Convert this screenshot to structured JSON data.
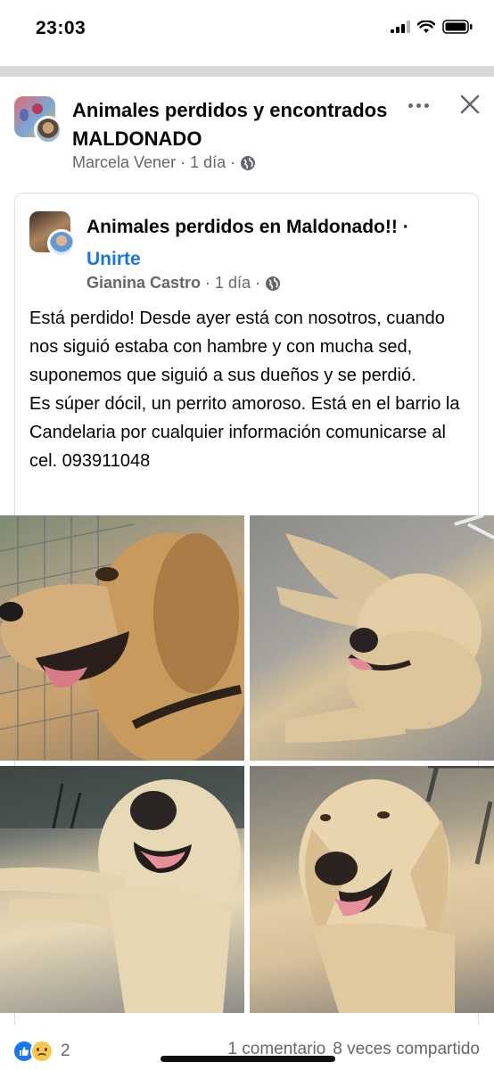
{
  "status_bar": {
    "time": "23:03"
  },
  "post": {
    "group_name": "Animales perdidos y encontrados MALDONADO",
    "author": "Marcela Vener",
    "separator": "·",
    "time": "1 día"
  },
  "shared_post": {
    "group_name": "Animales perdidos en Maldonado!!",
    "join_label": "Unirte",
    "author": "Gianina Castro",
    "time": "1 día",
    "body": "Está perdido! Desde ayer está con nosotros, cuando nos siguió estaba con hambre y con mucha sed, suponemos que siguió a sus dueños y se perdió.\nEs súper dócil, un perrito amoroso. Está en el barrio la Candelaria por  cualquier información comunicarse al cel. 093911048"
  },
  "footer": {
    "reaction_count": "2",
    "comments": "1 comentario",
    "shares": "8 veces compartido"
  },
  "colors": {
    "link": "#1b74e4",
    "meta": "#65676b",
    "divider": "#d7d9dd"
  },
  "icons": [
    "signal-icon",
    "wifi-icon",
    "battery-icon",
    "more-icon",
    "close-icon",
    "globe-icon",
    "like-reaction-icon",
    "sad-reaction-icon"
  ]
}
